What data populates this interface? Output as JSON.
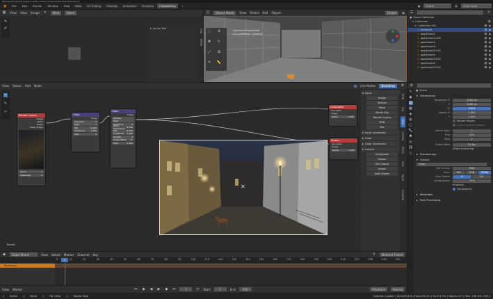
{
  "title_bar": "[Render.blend] [/all graphics 2020 scenery project] [data-final-final.blend]",
  "menu": [
    "File",
    "Edit",
    "Render",
    "Window",
    "Help"
  ],
  "workspace_tabs": [
    "Main",
    "UV Editing",
    "Shading",
    "Animation",
    "Scripting",
    "Compositing"
  ],
  "active_workspace": "Compositing",
  "top_right": {
    "scene": "Scene",
    "view_layer": "View Layer"
  },
  "image_editor": {
    "menu": [
      "View",
      "View",
      "Image"
    ],
    "new_label": "New",
    "open_label": "Open",
    "sidebar_tab": "Active Tool",
    "side_tabs": [
      "Tool",
      "Image"
    ]
  },
  "viewport": {
    "mode": "Object Mode",
    "menu": [
      "View",
      "Select",
      "Add",
      "Object"
    ],
    "orientation": "Global",
    "camera_text": "Camera Perspective",
    "collection_text": "(1) Collection | apollo1"
  },
  "outliner": {
    "header": "Scene Collection",
    "collection": "Collection",
    "items": [
      "Collection.001",
      "armature",
      "apartment1",
      "apartment1.001",
      "apartment2",
      "apartment3",
      "apartment3.001",
      "apartment4",
      "apartment4.001",
      "apartment5",
      "apartment5.001"
    ]
  },
  "node_editor": {
    "menu": [
      "View",
      "Select",
      "Add",
      "Node"
    ],
    "use_nodes_label": "Use Nodes",
    "backdrop_label": "Backdrop",
    "footer_label": "Scene",
    "nodes": {
      "render_layers": {
        "title": "Render Layers",
        "outputs": [
          "Image",
          "Alpha",
          "Depth",
          "Noisy Image"
        ],
        "scene": "Scene",
        "layer": "ViewLayer"
      },
      "glare": {
        "title": "Glare",
        "outputs": [
          "Image"
        ],
        "fields": [
          "Fog Glow",
          "High",
          "Mix",
          "Threshold",
          "Size"
        ],
        "values": [
          "",
          "",
          "0.000",
          "1.000",
          "8"
        ]
      },
      "glare2": {
        "title": "Glare",
        "outputs": [
          "Image"
        ],
        "fields": [
          "Streaks",
          "High",
          "Iterations",
          "Color Modulation",
          "Mix",
          "Threshold",
          "Streaks",
          "Angle Offset",
          "Fade"
        ],
        "values": [
          "",
          "",
          "3",
          "0.250",
          "0.000",
          "1.000",
          "4",
          "0°",
          "0.900"
        ]
      },
      "composite": {
        "title": "Composite",
        "fields": [
          "Use Alpha",
          "Image",
          "Alpha"
        ],
        "values": [
          "",
          "",
          "1.000"
        ]
      },
      "viewer": {
        "title": "Viewer",
        "fields": [
          "Use Alpha",
          "Image",
          "Alpha"
        ],
        "values": [
          "",
          "",
          "1.000"
        ]
      }
    }
  },
  "add_menu": {
    "sections": [
      {
        "title": "Input",
        "items": [
          "Image",
          "Texture",
          "Mask",
          "Movie Clip",
          "Render Layers",
          "RGB",
          "Mix"
        ]
      },
      {
        "title": "Input Advanced",
        "items": []
      },
      {
        "title": "Color",
        "items": []
      },
      {
        "title": "Color Advanced",
        "items": []
      },
      {
        "title": "Output",
        "items": [
          "Composite",
          "Viewer",
          "File Output",
          "Levels",
          "Split Viewer"
        ]
      }
    ],
    "side_tabs": [
      "Node",
      "Tool",
      "View",
      "Options",
      "Group",
      "Item",
      "Utility",
      "Relations"
    ]
  },
  "properties": {
    "scene_label": "Scene",
    "sections": {
      "dimensions": "Dimensions",
      "output": "Output",
      "metadata": "Metadata",
      "post": "Post Processing"
    },
    "rows": [
      {
        "k": "Resolution X",
        "v": "1920 px"
      },
      {
        "k": "Y",
        "v": "1080 px"
      },
      {
        "k": "%",
        "v": "100%"
      },
      {
        "k": "Aspect X",
        "v": "1.000"
      },
      {
        "k": "Y",
        "v": "1.000"
      }
    ],
    "render_region": "Render Region",
    "crop": "Crop to Render Region",
    "frames": [
      {
        "k": "Frame Start",
        "v": "1"
      },
      {
        "k": "End",
        "v": "250"
      },
      {
        "k": "Step",
        "v": "1"
      }
    ],
    "frame_rate": {
      "k": "Frame Rate",
      "v": "24 fps"
    },
    "time_stretching": "Time Stretching",
    "stereoscopy": "Stereoscopy",
    "render_display": "Render Display",
    "output_path": "/tmp\\",
    "file_format": {
      "k": "File Format",
      "v": "PNG"
    },
    "color": {
      "k": "Color",
      "opts": [
        "BW",
        "RGB",
        "RGBA"
      ]
    },
    "color_depth": {
      "k": "Color Depth",
      "opts": [
        "8",
        "16"
      ]
    },
    "compression": {
      "k": "Compression",
      "v": "15%"
    },
    "options": "Options",
    "overwrite": "Overwrite",
    "placeholders": "Placeholders",
    "file_extensions": "File Extensions",
    "cache": "Cache Result",
    "transparent": "Transparent",
    "color_mgmt": "Color Management"
  },
  "timeline": {
    "editor": "Dope Sheet",
    "menu": [
      "View",
      "Select",
      "Marker",
      "Channel",
      "Key"
    ],
    "summary": "Summary",
    "filter": "Nearest Frame",
    "ticks": [
      "0",
      "10",
      "20",
      "30",
      "40",
      "50",
      "60",
      "70",
      "80",
      "90",
      "100",
      "110",
      "120",
      "130",
      "140",
      "150",
      "160",
      "170",
      "180",
      "190",
      "200",
      "210",
      "220",
      "230",
      "240",
      "250"
    ],
    "current_frame": "1"
  },
  "playback": {
    "menu": [
      "View",
      "Marker"
    ],
    "frame": "1",
    "start_label": "Start",
    "start": "1",
    "end_label": "End",
    "end": "250",
    "playback": "Playback",
    "keying": "Keying"
  },
  "status_bar": {
    "items": [
      "Select",
      "Move",
      "Pan View",
      "Rotate View"
    ],
    "stats": "Collection | apollo1 | Verts:263,120 | Faces:263,411 | Tris:511,782 | Objects:1/47 | Mem: 1.96 GiB | 2.83.5"
  },
  "colors": {
    "accent": "#4772b3",
    "orange": "#ff8c00",
    "node_red": "#b33c3c",
    "node_blue": "#2e3f63",
    "node_purple": "#4a4077"
  }
}
